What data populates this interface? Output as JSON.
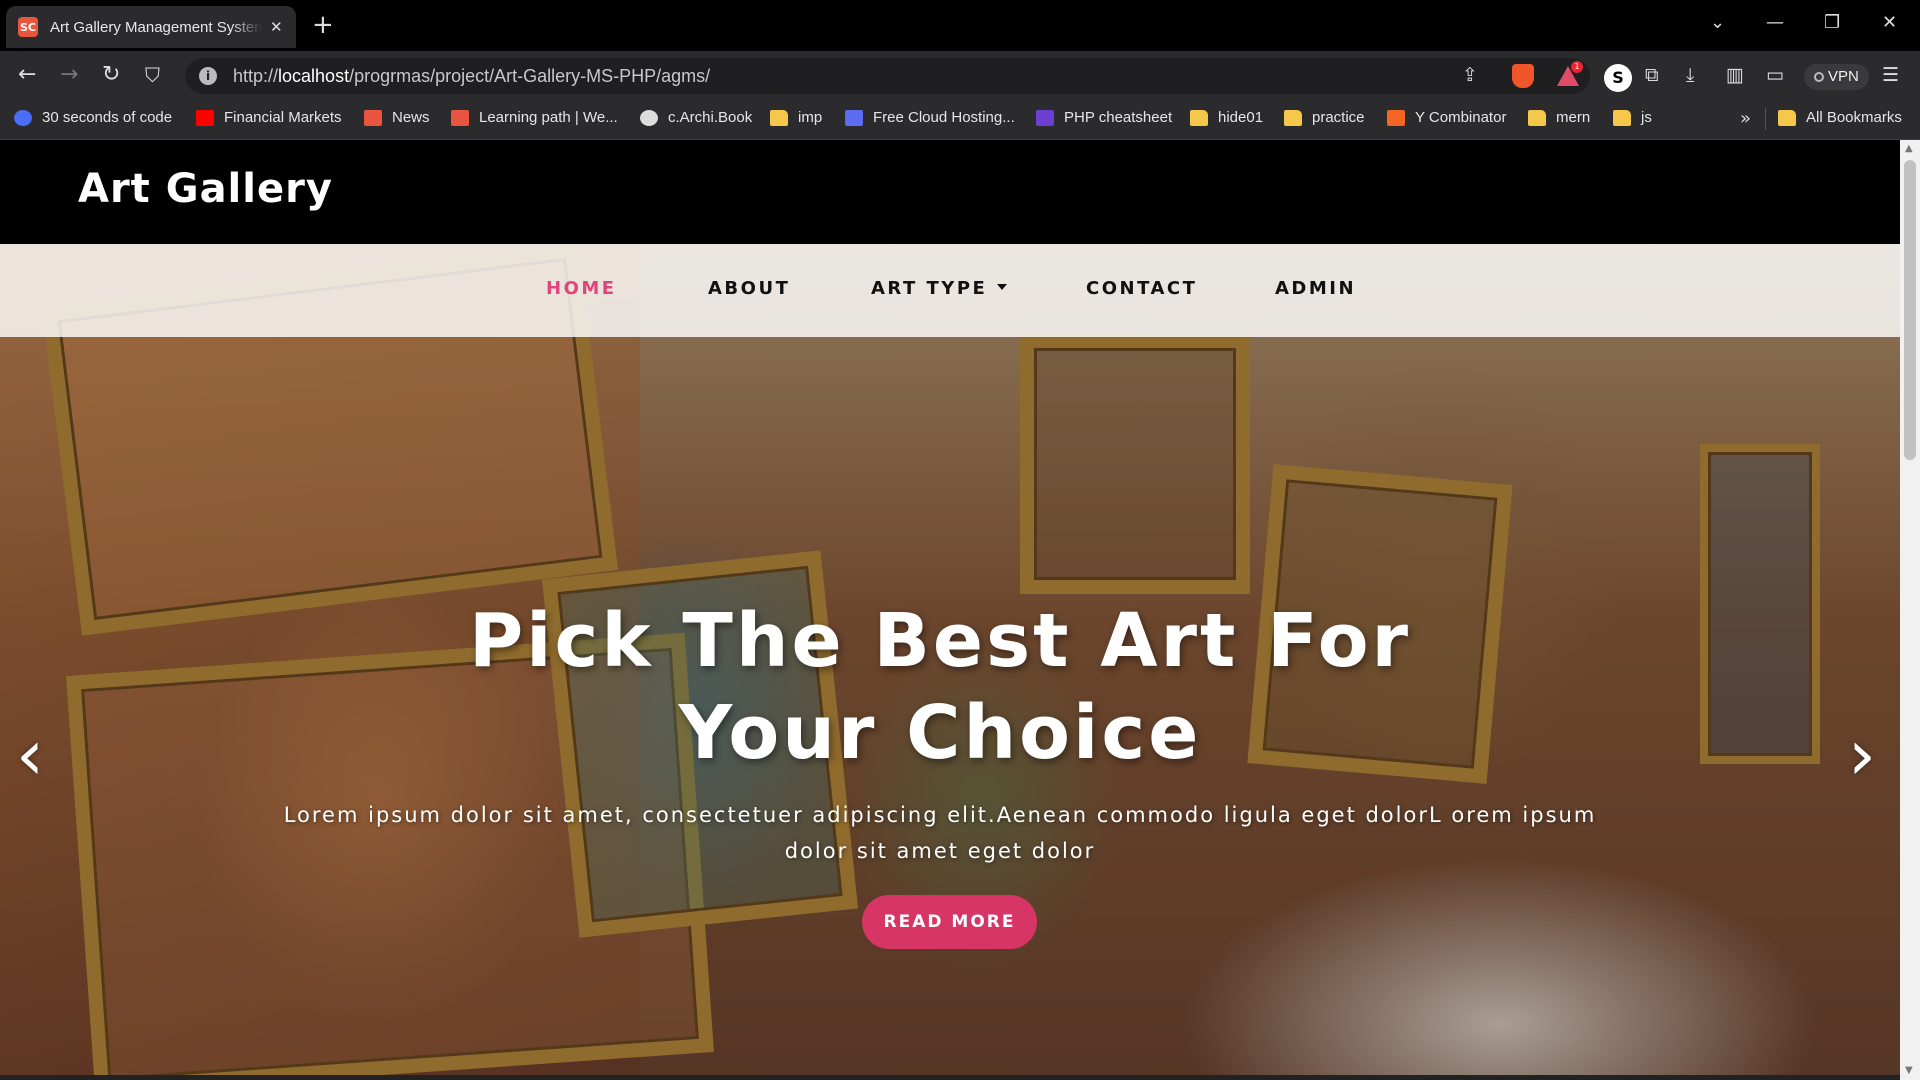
{
  "browser": {
    "tab_title": "Art Gallery Management System",
    "favicon_text": "SC",
    "url_prefix": "http://",
    "url_host": "localhost",
    "url_path": "/progrmas/project/Art-Gallery-MS-PHP/agms/",
    "profile_initial": "S",
    "rewards_badge": "1",
    "vpn_label": "VPN",
    "bookmarks": [
      {
        "label": "30 seconds of code",
        "icon": "code-icon",
        "color": "#4a6cf7"
      },
      {
        "label": "Financial Markets",
        "icon": "youtube-icon",
        "color": "#ff0000"
      },
      {
        "label": "News",
        "icon": "bolt-icon",
        "color": "#e8563f"
      },
      {
        "label": "Learning path | We...",
        "icon": "bolt-icon",
        "color": "#e8563f"
      },
      {
        "label": "c.Archi.Book",
        "icon": "globe-icon",
        "color": "#dddddd"
      },
      {
        "label": "imp",
        "icon": "folder-icon",
        "color": "#f5c84c"
      },
      {
        "label": "Free Cloud Hosting...",
        "icon": "vercel-icon",
        "color": "#5b6cf0"
      },
      {
        "label": "PHP cheatsheet",
        "icon": "php-icon",
        "color": "#6c3fd1"
      },
      {
        "label": "hide01",
        "icon": "folder-icon",
        "color": "#f5c84c"
      },
      {
        "label": "practice",
        "icon": "folder-icon",
        "color": "#f5c84c"
      },
      {
        "label": "Y Combinator",
        "icon": "ycombinator-icon",
        "color": "#f26522"
      },
      {
        "label": "mern",
        "icon": "folder-icon",
        "color": "#f5c84c"
      },
      {
        "label": "js",
        "icon": "folder-icon",
        "color": "#f5c84c"
      }
    ],
    "all_bookmarks_label": "All Bookmarks"
  },
  "site": {
    "logo": "Art Gallery",
    "nav": [
      {
        "label": "HOME",
        "active": true
      },
      {
        "label": "ABOUT",
        "active": false
      },
      {
        "label": "ART TYPE",
        "active": false,
        "dropdown": true
      },
      {
        "label": "CONTACT",
        "active": false
      },
      {
        "label": "ADMIN",
        "active": false
      }
    ],
    "hero": {
      "title_line1": "Pick The Best Art For",
      "title_line2": "Your Choice",
      "text": "Lorem ipsum dolor sit amet, consectetuer adipiscing elit.Aenean commodo ligula eget dolorL orem ipsum dolor sit amet eget dolor",
      "button": "READ MORE",
      "prev_icon": "chevron-left-icon",
      "next_icon": "chevron-right-icon"
    },
    "accent_color": "#e0457b",
    "button_color": "#d63565"
  }
}
